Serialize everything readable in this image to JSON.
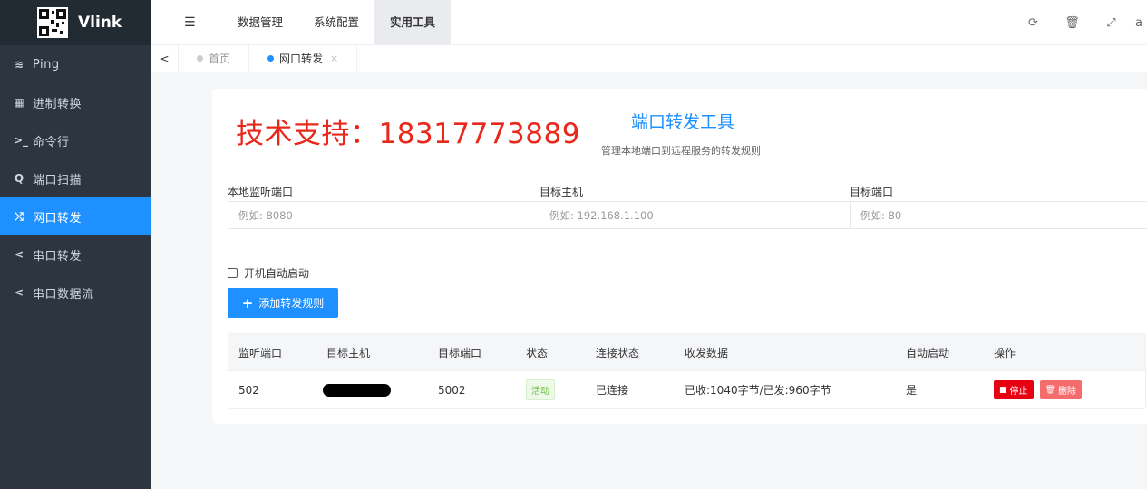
{
  "app": {
    "name": "Vlink"
  },
  "sidebar": {
    "items": [
      {
        "icon": "wifi-icon",
        "glyph": "≋",
        "label": "Ping",
        "active": false
      },
      {
        "icon": "calculator-icon",
        "glyph": "▦",
        "label": "进制转换",
        "active": false
      },
      {
        "icon": "terminal-icon",
        "glyph": ">_",
        "label": "命令行",
        "active": false
      },
      {
        "icon": "search-icon",
        "glyph": "Q",
        "label": "端口扫描",
        "active": false
      },
      {
        "icon": "shuffle-icon",
        "glyph": "⤮",
        "label": "网口转发",
        "active": true
      },
      {
        "icon": "share-icon",
        "glyph": "<",
        "label": "串口转发",
        "active": false
      },
      {
        "icon": "share-icon",
        "glyph": "<",
        "label": "串口数据流",
        "active": false
      }
    ]
  },
  "topnav": {
    "items": [
      {
        "label": "数据管理",
        "active": false
      },
      {
        "label": "系统配置",
        "active": false
      },
      {
        "label": "实用工具",
        "active": true
      }
    ]
  },
  "tabs": [
    {
      "label": "首页",
      "active": false
    },
    {
      "label": "网口转发",
      "active": true,
      "close": "×"
    }
  ],
  "content": {
    "support_text": "技术支持：18317773889",
    "title": "端口转发工具",
    "subtitle": "管理本地端口到远程服务的转发规则",
    "fields": [
      {
        "label": "本地监听端口",
        "placeholder": "例如: 8080"
      },
      {
        "label": "目标主机",
        "placeholder": "例如: 192.168.1.100"
      },
      {
        "label": "目标端口",
        "placeholder": "例如: 80"
      }
    ],
    "autostart_label": "开机自动启动",
    "add_button": "添加转发规则"
  },
  "table": {
    "headers": [
      "监听端口",
      "目标主机",
      "目标端口",
      "状态",
      "连接状态",
      "收发数据",
      "自动启动",
      "操作"
    ],
    "rows": [
      {
        "listen_port": "502",
        "target_host": "",
        "target_port": "5002",
        "status": "活动",
        "conn_status": "已连接",
        "traffic": "已收:1040字节/已发:960字节",
        "autostart": "是",
        "stop": "停止",
        "delete": "删除"
      }
    ]
  },
  "colors": {
    "accent": "#1e90ff",
    "sidebar": "#2d3540",
    "support": "#e8281b",
    "stop": "#e60012",
    "delete": "#f56c6c"
  }
}
